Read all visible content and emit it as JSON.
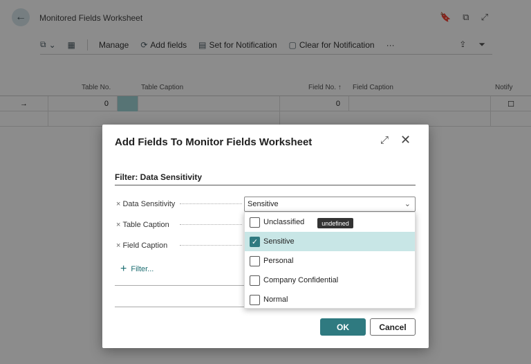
{
  "page": {
    "title": "Monitored Fields Worksheet",
    "toolbar": {
      "manage": "Manage",
      "add_fields": "Add fields",
      "set_notification": "Set for Notification",
      "clear_notification": "Clear for Notification",
      "more": "···"
    },
    "columns": [
      "Table No.",
      "Table Caption",
      "Field No. ↑",
      "Field Caption",
      "Notify"
    ],
    "row": {
      "table_no": "0",
      "field_no": "0"
    }
  },
  "dialog": {
    "title": "Add Fields To Monitor Fields Worksheet",
    "section_title": "Filter: Data Sensitivity",
    "filters": [
      {
        "label": "Data Sensitivity"
      },
      {
        "label": "Table Caption"
      },
      {
        "label": "Field Caption"
      }
    ],
    "data_sensitivity_value": "Sensitive",
    "add_filter": "Filter...",
    "ok": "OK",
    "cancel": "Cancel"
  },
  "dropdown": {
    "options": [
      {
        "label": "Unclassified",
        "checked": false
      },
      {
        "label": "Sensitive",
        "checked": true
      },
      {
        "label": "Personal",
        "checked": false
      },
      {
        "label": "Company Confidential",
        "checked": false
      },
      {
        "label": "Normal",
        "checked": false
      }
    ],
    "tooltip": "undefined"
  },
  "colors": {
    "accent": "#2f7a80",
    "selected_row": "#c8e6e6"
  }
}
